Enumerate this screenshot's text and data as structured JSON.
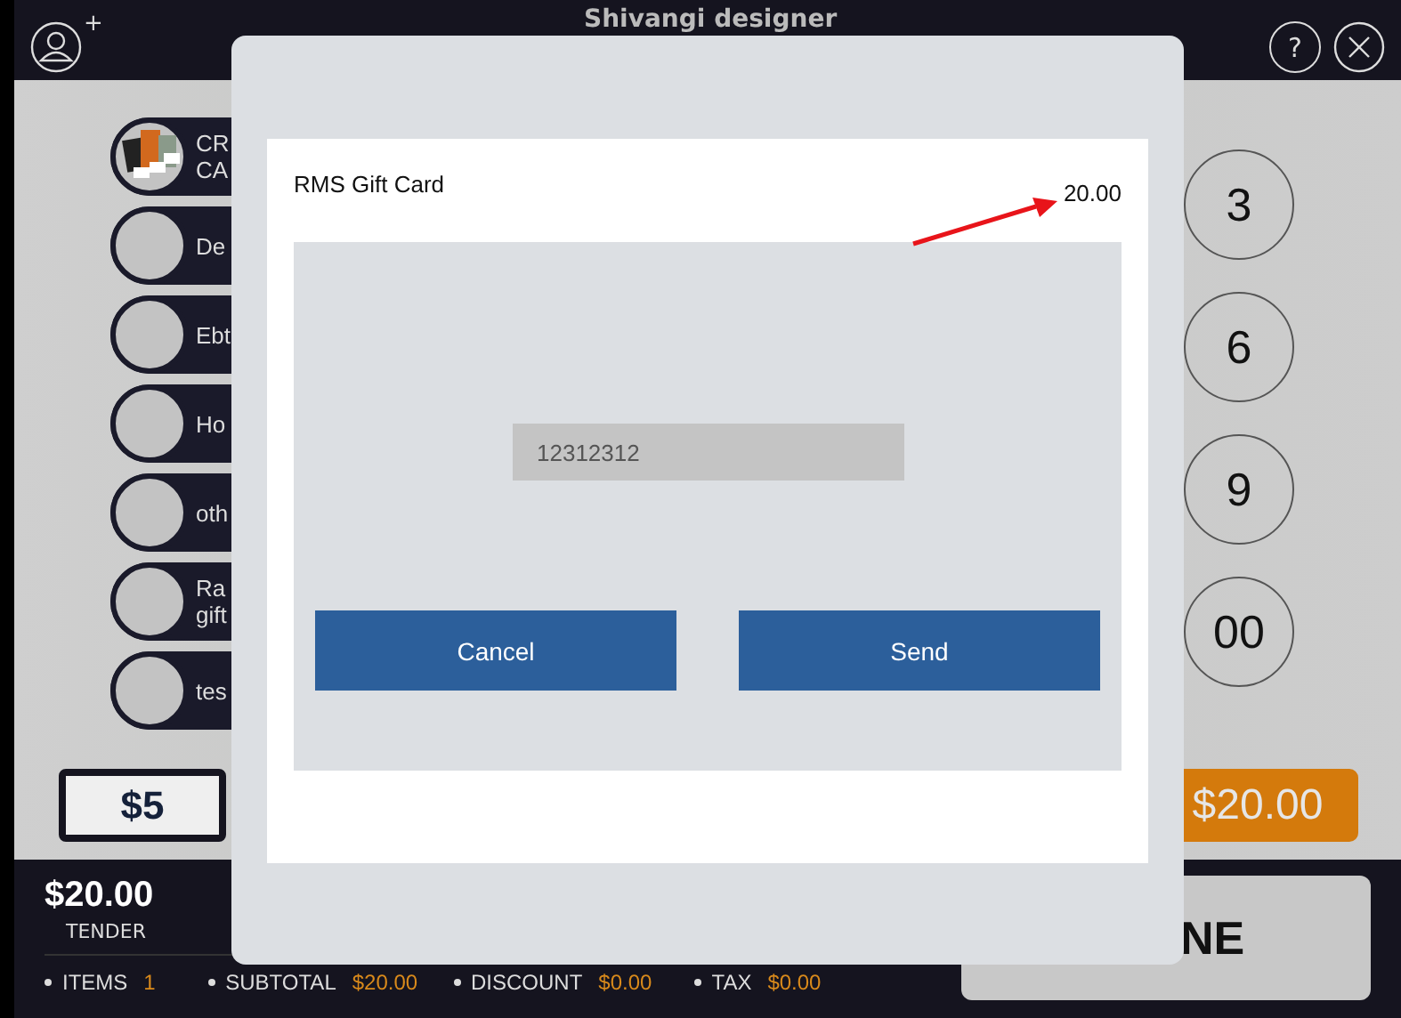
{
  "header": {
    "title": "Shivangi designer",
    "add_mark": "+",
    "help": "?"
  },
  "payment_methods": [
    {
      "label": "CR CA",
      "kind": "cards"
    },
    {
      "label": "De",
      "kind": "plain"
    },
    {
      "label": "Ebt",
      "kind": "plain"
    },
    {
      "label": "Ho",
      "kind": "plain"
    },
    {
      "label": "oth",
      "kind": "plain"
    },
    {
      "label": "Ra gift",
      "kind": "plain"
    },
    {
      "label": "tes",
      "kind": "plain"
    }
  ],
  "keypad": [
    "3",
    "6",
    "9",
    "00"
  ],
  "quick_amounts": {
    "bill": "$5",
    "exact": "$20.00"
  },
  "footer": {
    "tender_amount": "$20.00",
    "tender_label": "TENDER",
    "stats": [
      {
        "label": "ITEMS",
        "value": "1"
      },
      {
        "label": "SUBTOTAL",
        "value": "$20.00"
      },
      {
        "label": "DISCOUNT",
        "value": "$0.00"
      },
      {
        "label": "TAX",
        "value": "$0.00"
      }
    ],
    "done_button": "NE"
  },
  "dialog": {
    "title": "RMS Gift Card",
    "amount": "20.00",
    "input_value": "12312312",
    "buttons": [
      "Cancel",
      "Send"
    ]
  }
}
